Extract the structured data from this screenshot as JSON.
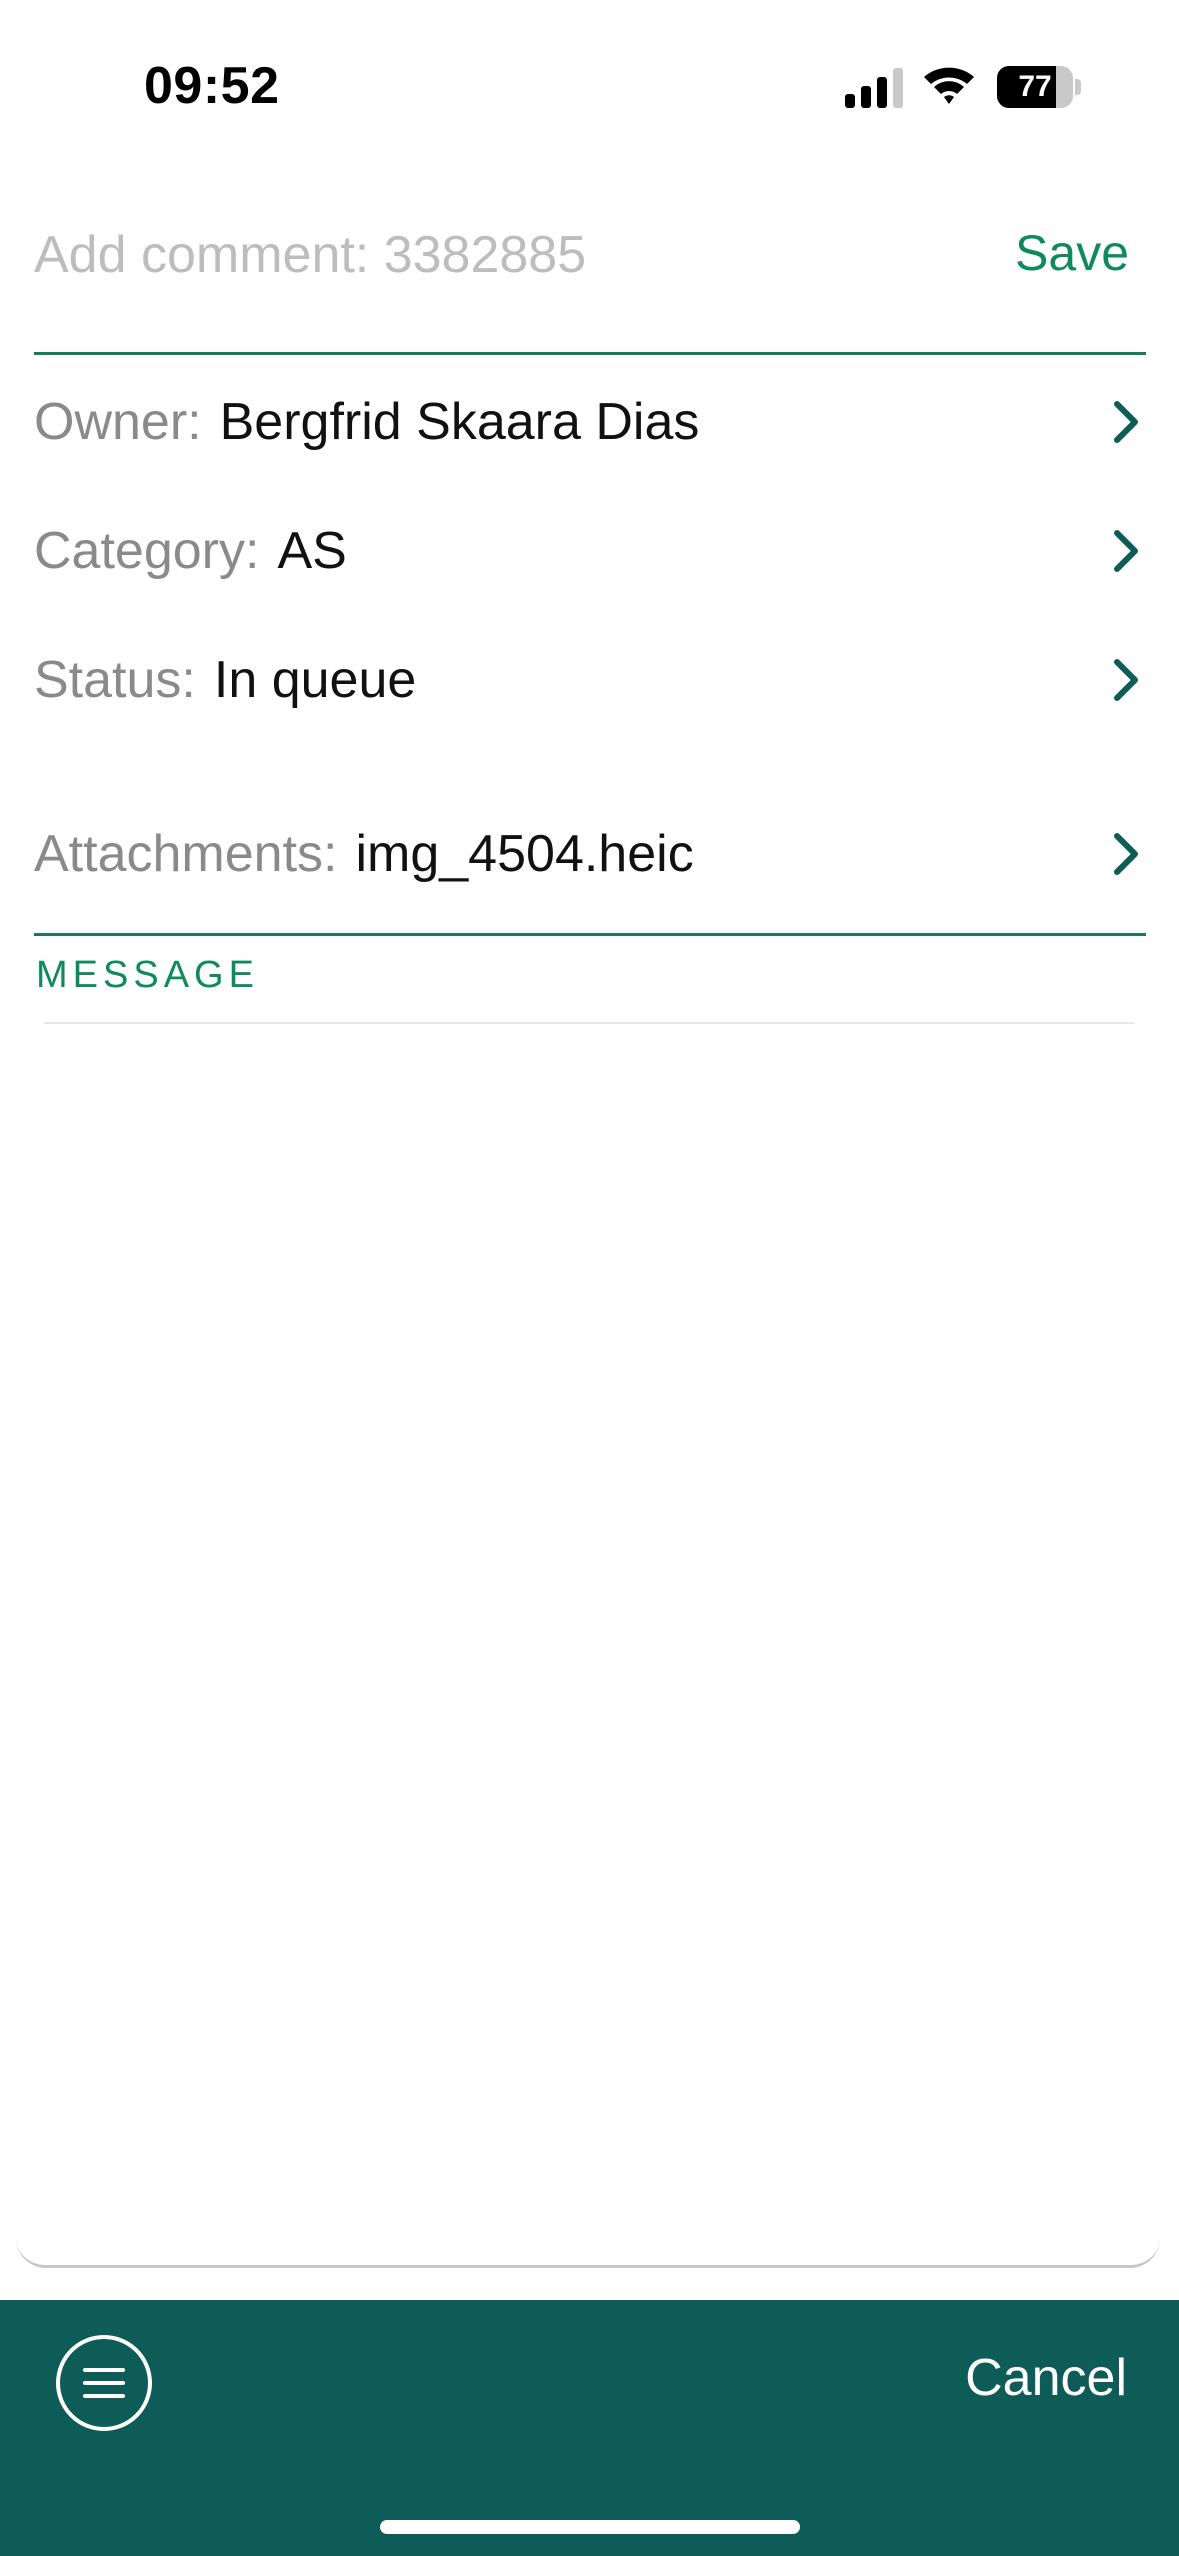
{
  "status_bar": {
    "time": "09:52",
    "battery_level": 77,
    "battery_text": "77",
    "icons": [
      "signal-icon",
      "wifi-icon",
      "battery-icon"
    ]
  },
  "comment": {
    "placeholder": "Add comment: 3382885",
    "value": "",
    "save_label": "Save"
  },
  "fields": {
    "owner": {
      "label": "Owner:",
      "value": "Bergfrid Skaara Dias"
    },
    "category": {
      "label": "Category:",
      "value": "AS"
    },
    "status": {
      "label": "Status:",
      "value": "In queue"
    },
    "attachments": {
      "label": "Attachments:",
      "value": "img_4504.heic"
    }
  },
  "message": {
    "section_label": "MESSAGE",
    "value": ""
  },
  "bottom_bar": {
    "menu_icon": "menu-icon",
    "cancel_label": "Cancel"
  },
  "colors": {
    "accent_green": "#0f8a5a",
    "bar_teal": "#0e5c58",
    "chevron": "#0e5c58",
    "label_gray": "#8a8a8a"
  }
}
